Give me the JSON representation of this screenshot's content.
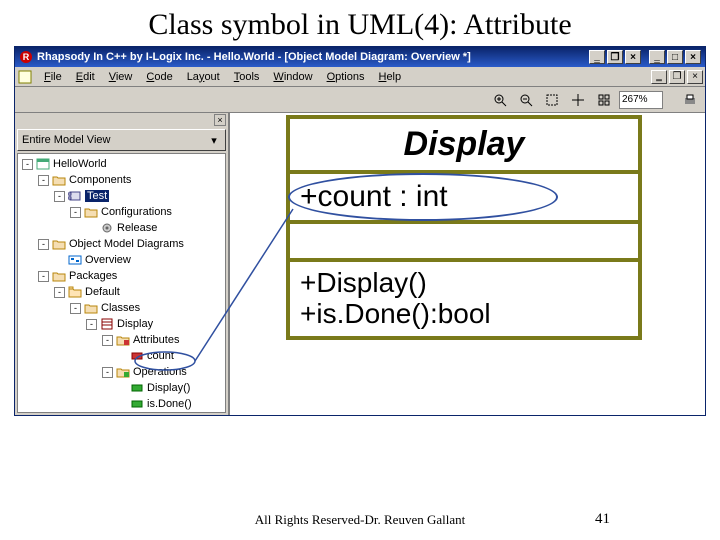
{
  "slide": {
    "title": "Class symbol in UML(4): Attribute",
    "footer": "All Rights Reserved-Dr. Reuven Gallant",
    "page": "41"
  },
  "window": {
    "title": "Rhapsody In C++ by I-Logix Inc. - Hello.World - [Object Model Diagram: Overview *]"
  },
  "menu": {
    "file": "File",
    "edit": "Edit",
    "view": "View",
    "code": "Code",
    "layout": "Layout",
    "tools": "Tools",
    "window": "Window",
    "options": "Options",
    "help": "Help"
  },
  "toolbar": {
    "zoom": "267%"
  },
  "browser": {
    "view_label": "Entire Model View",
    "tree": [
      {
        "ind": 0,
        "tw": "-",
        "icon": "project",
        "label": "HelloWorld"
      },
      {
        "ind": 1,
        "tw": "-",
        "icon": "folder",
        "label": "Components"
      },
      {
        "ind": 2,
        "tw": "-",
        "icon": "comp",
        "label": "Test",
        "sel": true
      },
      {
        "ind": 3,
        "tw": "-",
        "icon": "folder",
        "label": "Configurations"
      },
      {
        "ind": 4,
        "tw": "",
        "icon": "cfg",
        "label": "Release"
      },
      {
        "ind": 1,
        "tw": "-",
        "icon": "folder",
        "label": "Object Model Diagrams"
      },
      {
        "ind": 2,
        "tw": "",
        "icon": "omd",
        "label": "Overview"
      },
      {
        "ind": 1,
        "tw": "-",
        "icon": "folder",
        "label": "Packages"
      },
      {
        "ind": 2,
        "tw": "-",
        "icon": "pkg",
        "label": "Default"
      },
      {
        "ind": 3,
        "tw": "-",
        "icon": "folder",
        "label": "Classes"
      },
      {
        "ind": 4,
        "tw": "-",
        "icon": "class",
        "label": "Display"
      },
      {
        "ind": 5,
        "tw": "-",
        "icon": "folder-a",
        "label": "Attributes"
      },
      {
        "ind": 5,
        "tw": "",
        "icon": "attr",
        "label": "count",
        "extra_indent": 14
      },
      {
        "ind": 5,
        "tw": "-",
        "icon": "folder-o",
        "label": "Operations"
      },
      {
        "ind": 5,
        "tw": "",
        "icon": "op",
        "label": "Display()",
        "extra_indent": 14
      },
      {
        "ind": 5,
        "tw": "",
        "icon": "op",
        "label": "is.Done()",
        "extra_indent": 14
      }
    ]
  },
  "uml": {
    "name": "Display",
    "attribute": "+count : int",
    "op1": "+Display()",
    "op2": "+is.Done():bool"
  }
}
